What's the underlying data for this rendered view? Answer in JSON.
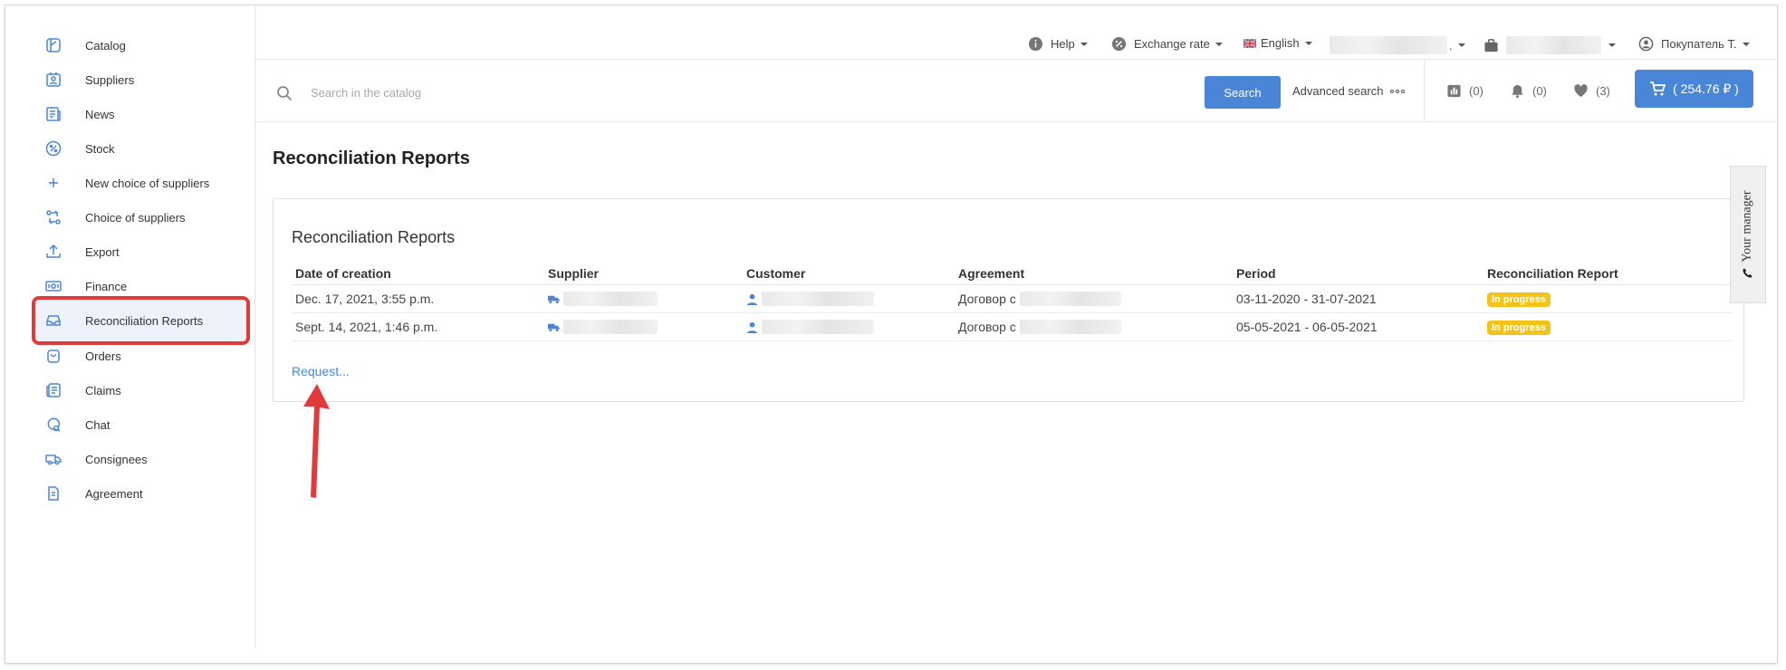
{
  "sidebar": {
    "items": [
      {
        "label": "Catalog",
        "icon": "catalog-icon"
      },
      {
        "label": "Suppliers",
        "icon": "suppliers-icon"
      },
      {
        "label": "News",
        "icon": "news-icon"
      },
      {
        "label": "Stock",
        "icon": "percent-icon"
      },
      {
        "label": "New choice of suppliers",
        "icon": "plus-icon"
      },
      {
        "label": "Choice of suppliers",
        "icon": "swap-icon"
      },
      {
        "label": "Export",
        "icon": "upload-icon"
      },
      {
        "label": "Finance",
        "icon": "money-icon"
      },
      {
        "label": "Reconciliation Reports",
        "icon": "inbox-icon",
        "active": true
      },
      {
        "label": "Orders",
        "icon": "shopping-bag-icon"
      },
      {
        "label": "Claims",
        "icon": "claims-icon"
      },
      {
        "label": "Chat",
        "icon": "chat-icon"
      },
      {
        "label": "Consignees",
        "icon": "truck-icon"
      },
      {
        "label": "Agreement",
        "icon": "document-icon"
      }
    ]
  },
  "header": {
    "help": "Help",
    "exchange_rate": "Exchange rate",
    "language": "English",
    "user": "Покупатель Т."
  },
  "search": {
    "placeholder": "Search in the catalog",
    "button": "Search",
    "advanced": "Advanced search"
  },
  "counters": {
    "compare": "(0)",
    "notifications": "(0)",
    "favorites": "(3)",
    "cart": "( 254.76 ₽ )"
  },
  "page": {
    "title": "Reconciliation Reports",
    "card_title": "Reconciliation Reports",
    "request_link": "Request..."
  },
  "table": {
    "headers": [
      "Date of creation",
      "Supplier",
      "Customer",
      "Agreement",
      "Period",
      "Reconciliation Report"
    ],
    "rows": [
      {
        "date": "Dec. 17, 2021, 3:55 p.m.",
        "agreement": "Договор с",
        "period": "03-11-2020 - 31-07-2021",
        "status": "In progress"
      },
      {
        "date": "Sept. 14, 2021, 1:46 p.m.",
        "agreement": "Договор с",
        "period": "05-05-2021 - 06-05-2021",
        "status": "In progress"
      }
    ]
  },
  "manager_tab": "Your manager",
  "colors": {
    "accent": "#4a86d8",
    "badge": "#f2c41a",
    "highlight": "#e03a3a"
  }
}
